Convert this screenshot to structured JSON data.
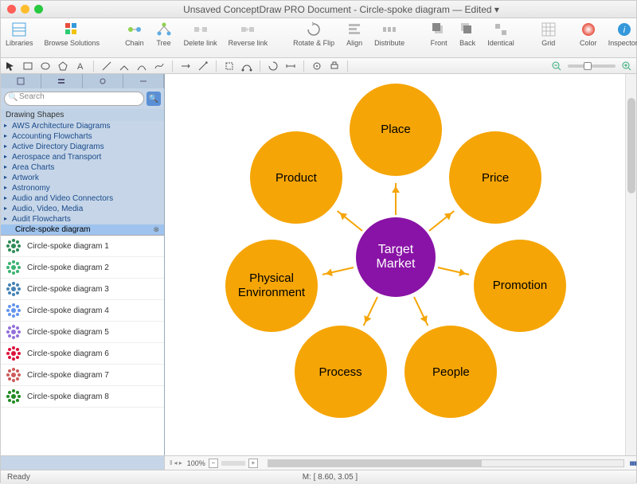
{
  "window": {
    "title": "Unsaved ConceptDraw PRO Document - Circle-spoke diagram — Edited ▾"
  },
  "toolbar": {
    "libraries": "Libraries",
    "browse": "Browse Solutions",
    "chain": "Chain",
    "tree": "Tree",
    "deletelink": "Delete link",
    "reverselink": "Reverse link",
    "rotateflip": "Rotate & Flip",
    "align": "Align",
    "distribute": "Distribute",
    "front": "Front",
    "back": "Back",
    "identical": "Identical",
    "grid": "Grid",
    "color": "Color",
    "inspectors": "Inspectors"
  },
  "search": {
    "placeholder": "Search"
  },
  "sidebar": {
    "header": "Drawing Shapes",
    "categories": [
      "AWS Architecture Diagrams",
      "Accounting Flowcharts",
      "Active Directory Diagrams",
      "Aerospace and Transport",
      "Area Charts",
      "Artwork",
      "Astronomy",
      "Audio and Video Connectors",
      "Audio, Video, Media",
      "Audit Flowcharts"
    ],
    "selected": "Circle-spoke diagram",
    "thumbs": [
      "Circle-spoke diagram 1",
      "Circle-spoke diagram 2",
      "Circle-spoke diagram 3",
      "Circle-spoke diagram 4",
      "Circle-spoke diagram 5",
      "Circle-spoke diagram 6",
      "Circle-spoke diagram 7",
      "Circle-spoke diagram 8"
    ]
  },
  "diagram": {
    "center": "Target\nMarket",
    "spokes": [
      "Place",
      "Price",
      "Promotion",
      "People",
      "Process",
      "Physical Environment",
      "Product"
    ]
  },
  "footer": {
    "zoom": "100%",
    "status_left": "Ready",
    "status_center": "M: [ 8.60, 3.05 ]"
  },
  "colors": {
    "spoke": "#f5a506",
    "center": "#8913a6"
  },
  "chart_data": {
    "type": "diagram",
    "layout": "circle-spoke",
    "center_node": {
      "label": "Target Market",
      "color": "#8913a6"
    },
    "spoke_nodes": [
      {
        "label": "Place"
      },
      {
        "label": "Price"
      },
      {
        "label": "Promotion"
      },
      {
        "label": "People"
      },
      {
        "label": "Process"
      },
      {
        "label": "Physical Environment"
      },
      {
        "label": "Product"
      }
    ],
    "spoke_color": "#f5a506",
    "title": "Circle-spoke diagram"
  }
}
